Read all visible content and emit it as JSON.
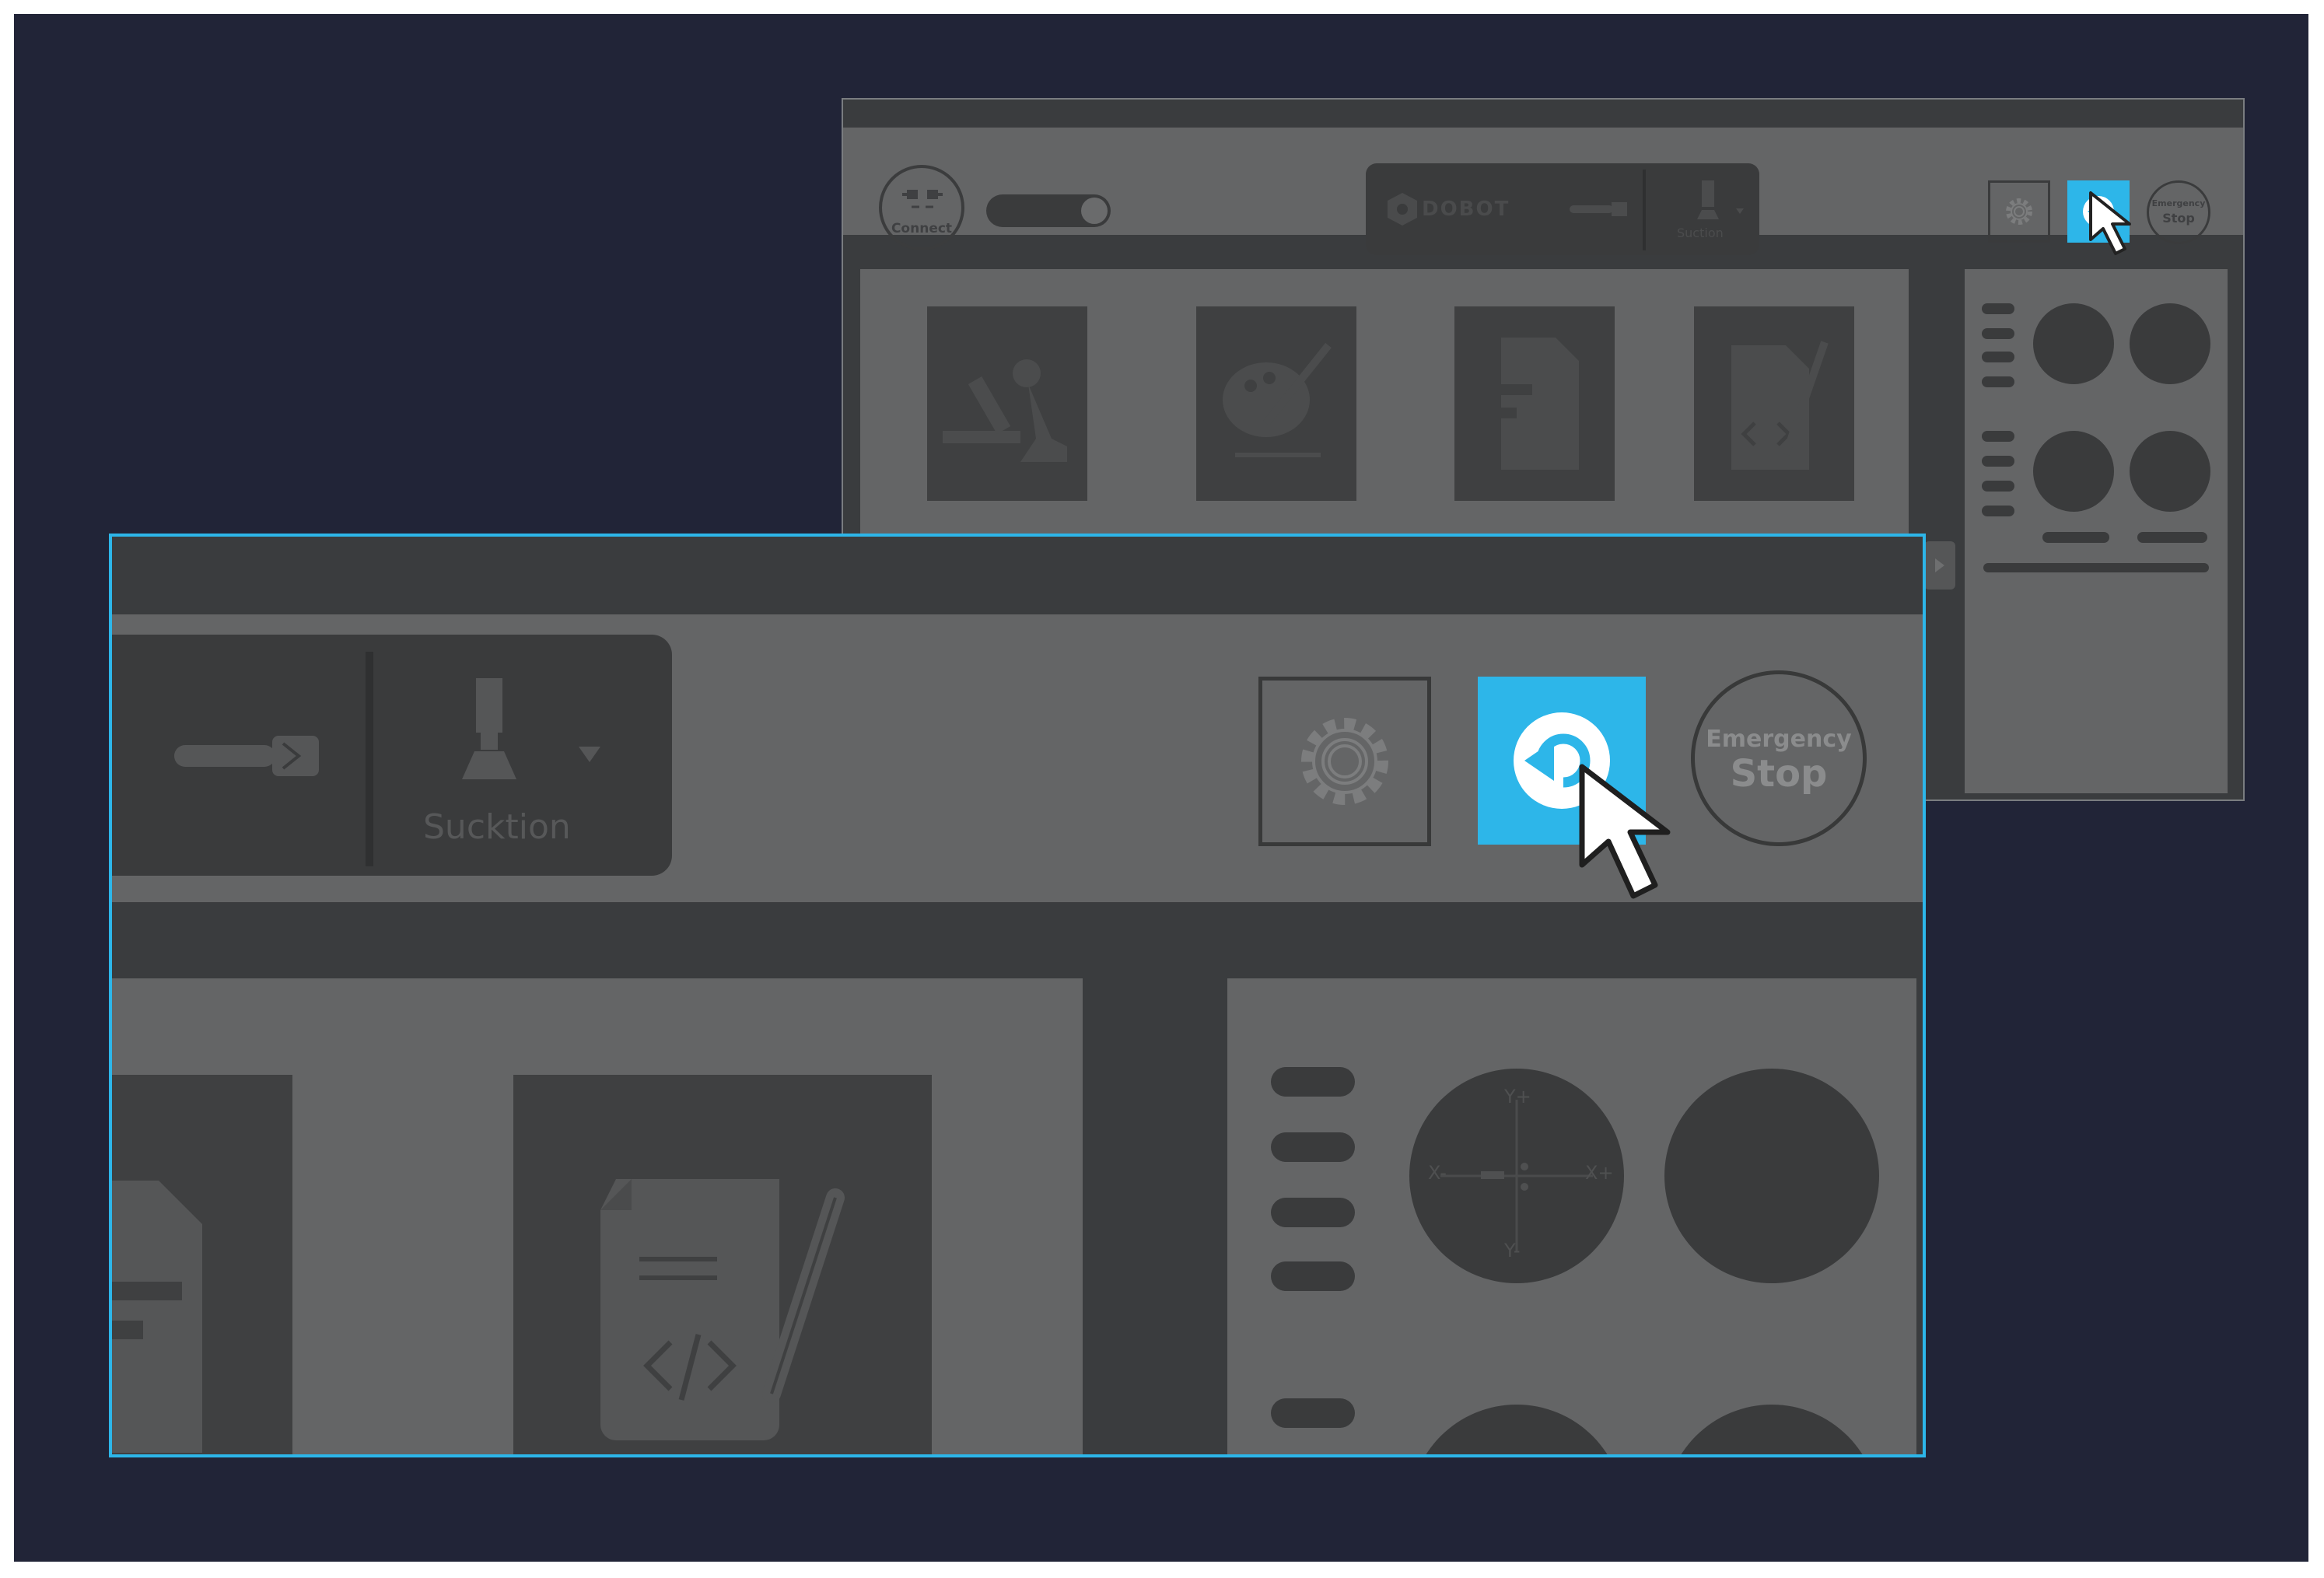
{
  "back_window": {
    "connect_label": "Connect",
    "device_brand": "DOBOT",
    "end_effector": "Suction",
    "emergency_line1": "Emergency",
    "emergency_line2": "Stop"
  },
  "zoom_window": {
    "end_effector": "Sucktion",
    "emergency_line1": "Emergency",
    "emergency_line2": "Stop"
  },
  "jog": {
    "y_plus": "Y+",
    "y_minus": "Y-",
    "x_plus": "X+",
    "x_minus": "X-"
  },
  "icons": {
    "connect": "plug-icon",
    "gear": "gear-icon",
    "back": "undo-arrow-icon",
    "cursor": "mouse-pointer-icon",
    "robot_arm": "robot-arm-icon",
    "palette": "palette-icon",
    "laser": "document-laser-icon",
    "script": "code-document-icon"
  },
  "colors": {
    "accent": "#2db6e9",
    "background": "#212437",
    "panel": "#646566",
    "dark": "#3a3b3c"
  }
}
